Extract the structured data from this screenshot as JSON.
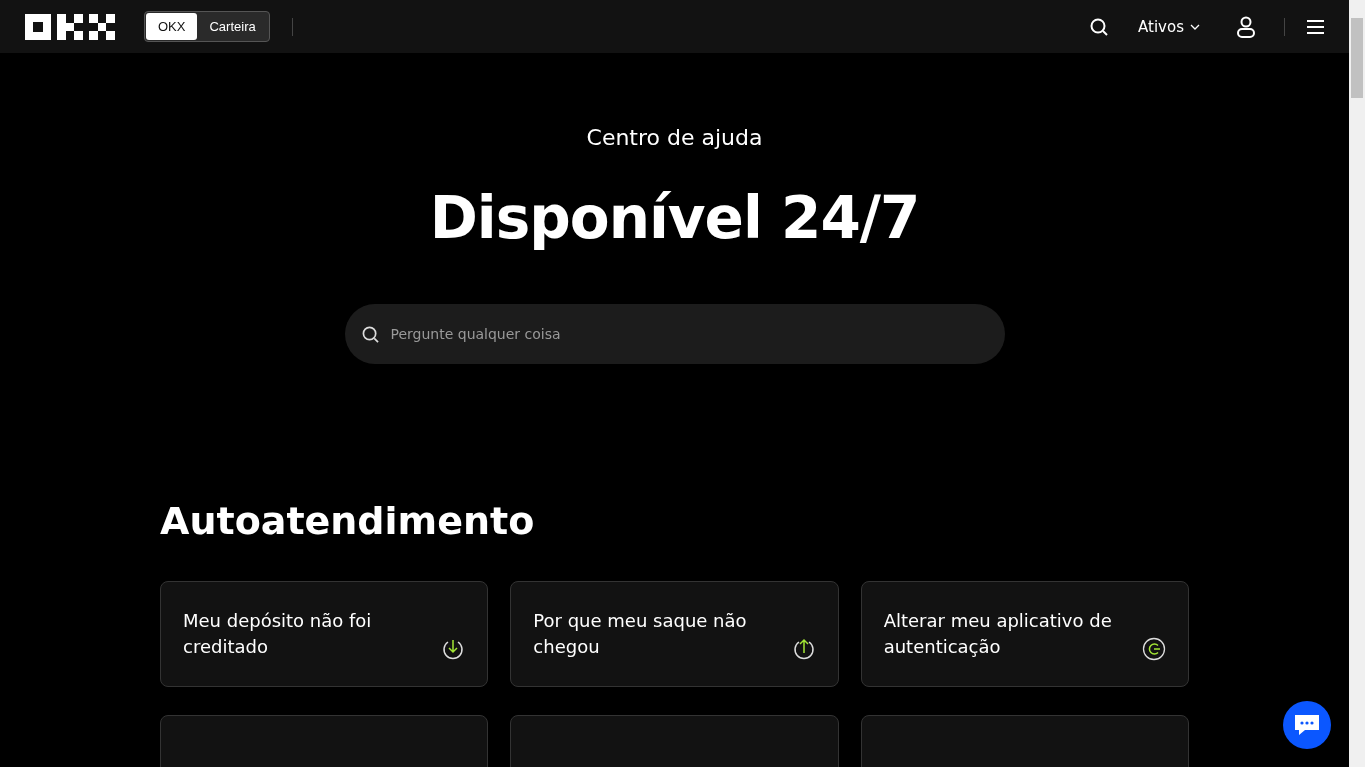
{
  "header": {
    "switch": [
      {
        "label": "OKX",
        "selected": true
      },
      {
        "label": "Carteira",
        "selected": false
      }
    ],
    "assets_menu": "Ativos"
  },
  "hero": {
    "eyebrow": "Centro de ajuda",
    "title": "Disponível 24/7",
    "search": {
      "placeholder": "Pergunte qualquer coisa"
    }
  },
  "self_service": {
    "title": "Autoatendimento",
    "cards": [
      {
        "text": "Meu depósito não foi creditado",
        "kind": "deposit"
      },
      {
        "text": "Por que meu saque não chegou",
        "kind": "withdraw"
      },
      {
        "text": "Alterar meu aplicativo de autenticação",
        "kind": "authenticator"
      }
    ]
  }
}
